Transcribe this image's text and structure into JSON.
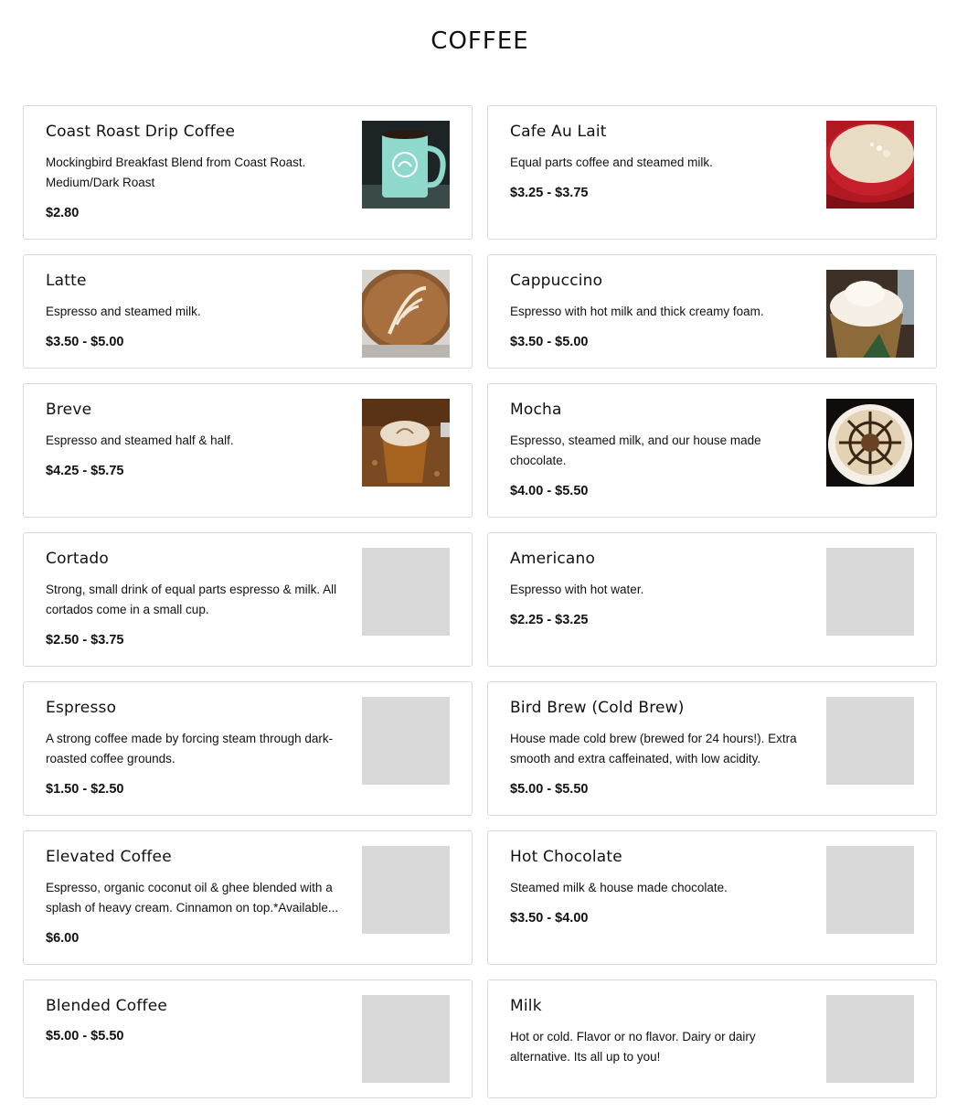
{
  "page": {
    "title": "COFFEE"
  },
  "items": [
    {
      "name": "Coast Roast Drip Coffee",
      "description": "Mockingbird Breakfast Blend from Coast Roast. Medium/Dark Roast",
      "price": "$2.80",
      "image": "teal-mug-photo"
    },
    {
      "name": "Cafe Au Lait",
      "description": "Equal parts coffee and steamed milk.",
      "price": "$3.25 - $3.75",
      "image": "red-cup-photo"
    },
    {
      "name": "Latte",
      "description": "Espresso and steamed milk.",
      "price": "$3.50 - $5.00",
      "image": "latte-art-photo"
    },
    {
      "name": "Cappuccino",
      "description": "Espresso with hot milk and thick creamy foam.",
      "price": "$3.50 - $5.00",
      "image": "foam-cup-photo"
    },
    {
      "name": "Breve",
      "description": "Espresso and steamed half & half.",
      "price": "$4.25 - $5.75",
      "image": "paper-cup-photo"
    },
    {
      "name": "Mocha",
      "description": "Espresso, steamed milk, and our house made chocolate.",
      "price": "$4.00 - $5.50",
      "image": "mocha-art-photo"
    },
    {
      "name": "Cortado",
      "description": "Strong, small drink of equal parts espresso & milk. All cortados come in a small cup.",
      "price": "$2.50 - $3.75",
      "image": "placeholder"
    },
    {
      "name": "Americano",
      "description": "Espresso with hot water.",
      "price": "$2.25 - $3.25",
      "image": "placeholder"
    },
    {
      "name": "Espresso",
      "description": "A strong coffee made by forcing steam through dark-roasted coffee grounds.",
      "price": "$1.50 - $2.50",
      "image": "placeholder"
    },
    {
      "name": "Bird Brew (Cold Brew)",
      "description": "House made cold brew (brewed for 24 hours!). Extra smooth and extra caffeinated, with low acidity.",
      "price": "$5.00 - $5.50",
      "image": "placeholder"
    },
    {
      "name": "Elevated Coffee",
      "description": "Espresso, organic coconut oil & ghee blended with a splash of heavy cream. Cinnamon on top.*Available...",
      "price": "$6.00",
      "image": "placeholder"
    },
    {
      "name": "Hot Chocolate",
      "description": "Steamed milk & house made chocolate.",
      "price": "$3.50 - $4.00",
      "image": "placeholder"
    },
    {
      "name": "Blended Coffee",
      "description": "",
      "price": "$5.00 - $5.50",
      "image": "placeholder"
    },
    {
      "name": "Milk",
      "description": "Hot or cold. Flavor or no flavor. Dairy or dairy alternative. Its all up to you!",
      "price": "",
      "image": "placeholder"
    }
  ]
}
